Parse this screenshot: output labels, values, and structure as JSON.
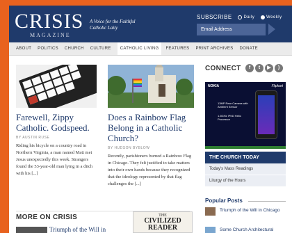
{
  "header": {
    "logo": "CRISIS",
    "logo_sub": "MAGAZINE",
    "tagline": "A Voice for the Faithful Catholic Laity",
    "subscribe_label": "SUBSCRIBE",
    "option_daily": "Daily",
    "option_weekly": "Weekly",
    "email_placeholder": "Email Address"
  },
  "nav": [
    "ABOUT",
    "POLITICS",
    "CHURCH",
    "CULTURE",
    "CATHOLIC LIVING",
    "FEATURES",
    "PRINT ARCHIVES",
    "DONATE"
  ],
  "articles": [
    {
      "title": "Farewell, Zippy Catholic. Godspeed.",
      "byline": "BY AUSTIN RUSE",
      "excerpt": "Riding his bicycle on a country road in Northern Virginia, a man named Matt met Jesus unexpectedly this week. Strangers found the 53-year-old man lying in a ditch with his [...]"
    },
    {
      "title": "Does a Rainbow Flag Belong in a Catholic Church?",
      "byline": "BY HUDSON BYBLOW",
      "excerpt": "Recently, parishioners burned a Rainbow Flag in Chicago. They felt justified to take matters into their own hands because they recognized that the ideology represented by that flag challenges the [...]"
    }
  ],
  "sidebar": {
    "connect": "CONNECT",
    "social_icons": [
      "facebook-icon",
      "twitter-icon",
      "youtube-icon",
      "rss-icon"
    ],
    "ad_brand": "NOKIA",
    "ad_retailer": "Flipkart",
    "ad_feature1": "13MP Rear Camera with Ambient Sensor",
    "ad_feature2": "1.6GHz IPhD Helio Processor",
    "church_today": "THE CHURCH TODAY",
    "church_links": [
      "Today's Mass Readings",
      "Liturgy of the Hours"
    ],
    "popular": "Popular Posts",
    "popular_items": [
      "Triumph of the Will in Chicago",
      "Some Church Architectural"
    ]
  },
  "more_title": "MORE ON CRISIS",
  "more_item": "Triumph of the Will in",
  "promo": {
    "line1": "THE",
    "line2": "CIVILIZED",
    "line3": "READER"
  },
  "colors": {
    "brand_navy": "#1f3a6b",
    "border_orange": "#e8621e"
  }
}
